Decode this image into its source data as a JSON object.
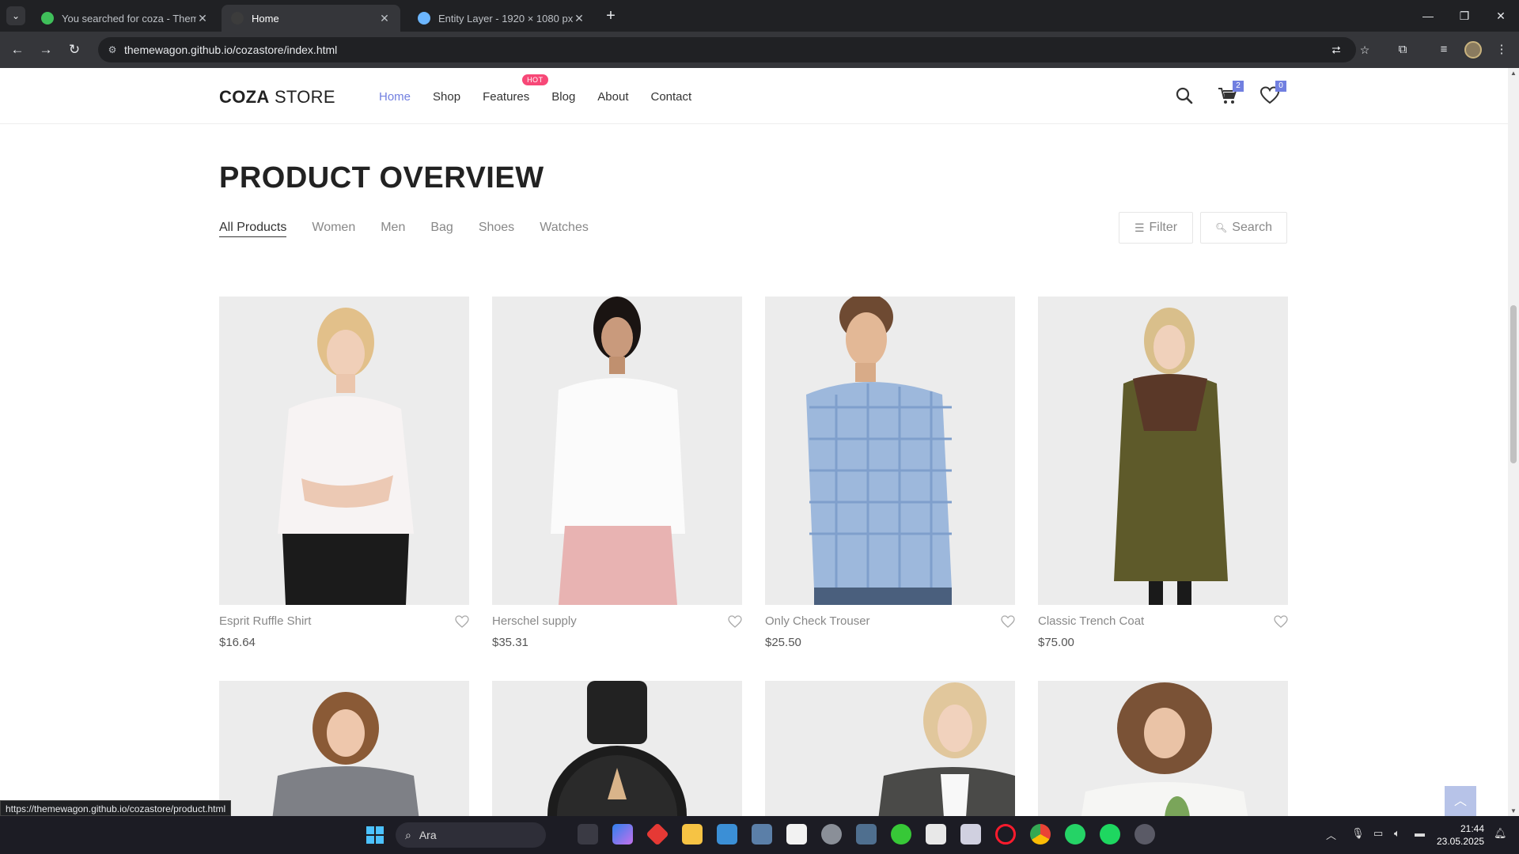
{
  "browser": {
    "tabs": [
      {
        "title": "You searched for coza - Themew",
        "favicon_color": "#3fbf5a",
        "active": false
      },
      {
        "title": "Home",
        "favicon_color": "#3c3c3c",
        "active": true
      },
      {
        "title": "Entity Layer - 1920 × 1080 px",
        "favicon_color": "#6cb6ff",
        "active": false
      }
    ],
    "url": "themewagon.github.io/cozastore/index.html",
    "status_url": "https://themewagon.github.io/cozastore/product.html"
  },
  "header": {
    "logo_bold": "COZA",
    "logo_light": "STORE",
    "menu": [
      {
        "label": "Home",
        "active": true
      },
      {
        "label": "Shop"
      },
      {
        "label": "Features",
        "badge": "HOT"
      },
      {
        "label": "Blog"
      },
      {
        "label": "About"
      },
      {
        "label": "Contact"
      }
    ],
    "cart_count": "2",
    "wishlist_count": "0",
    "accent_color": "#717fe0"
  },
  "overview": {
    "title": "PRODUCT OVERVIEW",
    "filters": [
      "All Products",
      "Women",
      "Men",
      "Bag",
      "Shoes",
      "Watches"
    ],
    "active_filter": "All Products",
    "filter_button": "Filter",
    "search_button": "Search"
  },
  "products": [
    {
      "name": "Esprit Ruffle Shirt",
      "price": "$16.64"
    },
    {
      "name": "Herschel supply",
      "price": "$35.31"
    },
    {
      "name": "Only Check Trouser",
      "price": "$25.50"
    },
    {
      "name": "Classic Trench Coat",
      "price": "$75.00"
    }
  ],
  "taskbar": {
    "search_label": "Ara",
    "time": "21:44",
    "date": "23.05.2025"
  }
}
